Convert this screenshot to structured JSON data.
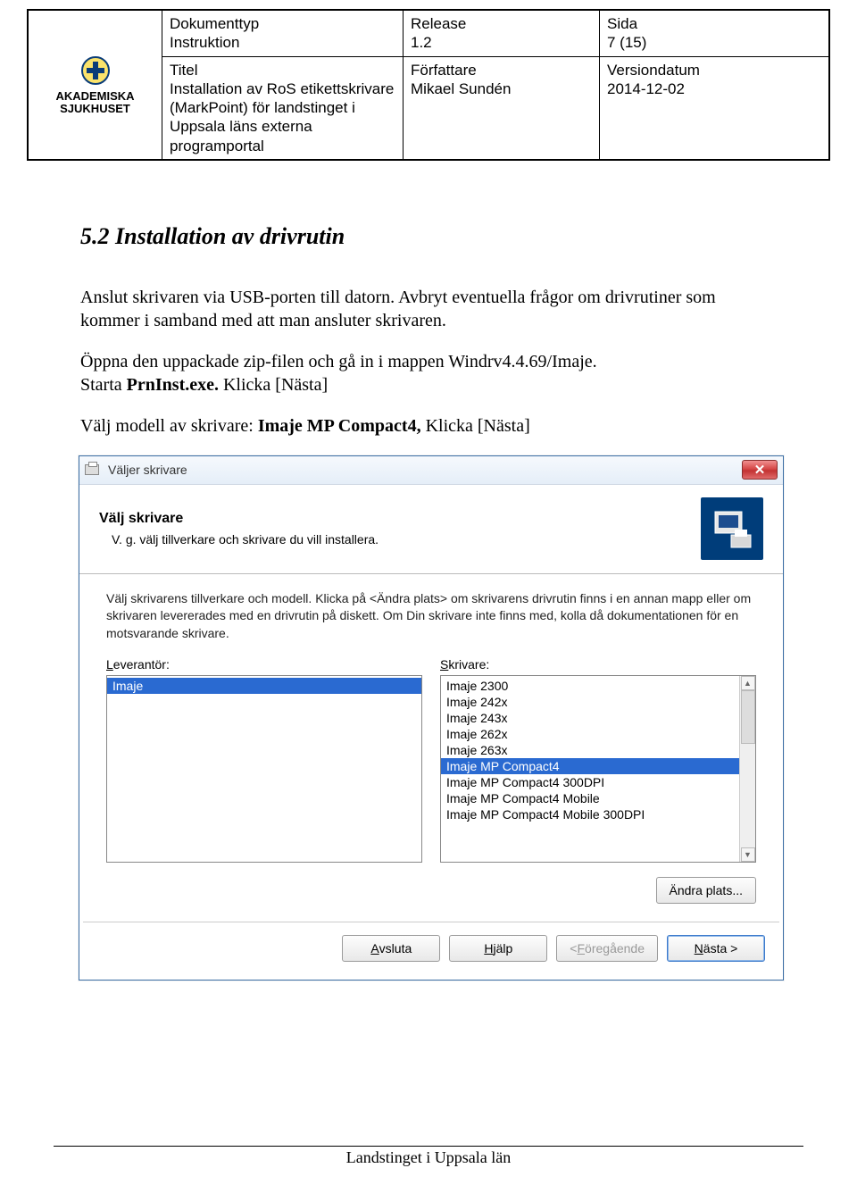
{
  "header": {
    "logo": {
      "line1": "AKADEMISKA",
      "line2": "SJUKHUSET"
    },
    "r1": {
      "c1_label": "Dokumenttyp",
      "c1_value": "Instruktion",
      "c2_label": "Release",
      "c2_value": "1.2",
      "c3_label": "Sida",
      "c3_value": "7 (15)"
    },
    "r2": {
      "c1_label": "Titel",
      "c1_value": "Installation av RoS etikettskrivare (MarkPoint) för landstinget i Uppsala läns externa programportal",
      "c2_label": "Författare",
      "c2_value": "Mikael Sundén",
      "c3_label": "Versiondatum",
      "c3_value": "2014-12-02"
    }
  },
  "section": {
    "num": "5.2",
    "title": "Installation  av drivrutin"
  },
  "para1": "Anslut skrivaren via USB-porten till datorn. Avbryt eventuella frågor om drivrutiner som kommer i samband med att man ansluter skrivaren.",
  "para2_pre": "Öppna den uppackade zip-filen och gå in i mappen Windrv4.4.69/Imaje.\nStarta ",
  "para2_bold": "PrnInst.exe.",
  "para2_post": " Klicka [Nästa]",
  "para3_pre": "Välj modell av skrivare: ",
  "para3_bold": "Imaje MP Compact4,",
  "para3_post": "  Klicka [Nästa]",
  "dialog": {
    "title": "Väljer skrivare",
    "banner_title": "Välj skrivare",
    "banner_sub": "V. g. välj tillverkare och skrivare du vill installera.",
    "instr": "Välj skrivarens tillverkare och modell. Klicka på <Ändra plats> om skrivarens drivrutin finns i en annan mapp eller om skrivaren levererades med en drivrutin på diskett. Om Din skrivare inte finns med, kolla då dokumentationen för en motsvarande skrivare.",
    "vendor_label_pre": "L",
    "vendor_label_post": "everantör:",
    "printer_label_pre": "S",
    "printer_label_post": "krivare:",
    "vendors": [
      "Imaje"
    ],
    "printers": [
      "Imaje 2300",
      "Imaje 242x",
      "Imaje 243x",
      "Imaje 262x",
      "Imaje 263x",
      "Imaje MP Compact4",
      "Imaje MP Compact4 300DPI",
      "Imaje MP Compact4 Mobile",
      "Imaje MP Compact4 Mobile 300DPI"
    ],
    "selected_printer_index": 5,
    "change_btn": "Ändra plats...",
    "btn_exit": "Avsluta",
    "btn_help": "Hjälp",
    "btn_prev": "< Föregående",
    "btn_next": "Nästa >"
  },
  "footer": "Landstinget i Uppsala län"
}
